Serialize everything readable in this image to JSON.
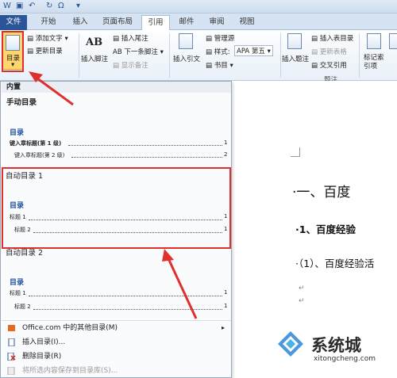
{
  "tabs": {
    "file": "文件",
    "home": "开始",
    "insert": "插入",
    "layout": "页面布局",
    "references": "引用",
    "mailings": "邮件",
    "review": "审阅",
    "view": "视图"
  },
  "ribbon": {
    "toc_button": "目录",
    "add_text": "添加文字",
    "update_toc": "更新目录",
    "insert_footnote": "插入脚注",
    "insert_endnote": "插入尾注",
    "next_footnote": "下一条脚注",
    "show_notes": "显示备注",
    "insert_citation": "插入引文",
    "manage_sources": "管理源",
    "style_label": "样式:",
    "style_value": "APA 第五",
    "bibliography": "书目",
    "insert_caption": "插入题注",
    "insert_table_of_figures": "插入表目录",
    "update_table": "更新表格",
    "cross_reference": "交叉引用",
    "captions_group": "题注",
    "mark_entry": "标记索引项",
    "footnote_icon_text": "AB",
    "citations_group_tail": "目"
  },
  "menu": {
    "header": "内置",
    "manual_title": "手动目录",
    "manual_preview": {
      "heading": "目录",
      "lines": [
        {
          "text": "键入章标题(第 1 级)",
          "page": "1"
        },
        {
          "text": "键入章标题(第 2 级)",
          "page": "2"
        }
      ]
    },
    "auto1_title": "自动目录 1",
    "auto1_preview": {
      "heading": "目录",
      "lines": [
        {
          "text": "标题 1",
          "page": "1"
        },
        {
          "text": "标题 2",
          "page": "1"
        }
      ]
    },
    "auto2_title": "自动目录 2",
    "auto2_preview": {
      "heading": "目录",
      "lines": [
        {
          "text": "标题 1",
          "page": "1"
        },
        {
          "text": "标题 2",
          "page": "1"
        }
      ]
    },
    "items": [
      {
        "label": "Office.com 中的其他目录(M)",
        "icon": "office-icon",
        "disabled": false
      },
      {
        "label": "插入目录(I)...",
        "icon": "document-icon",
        "disabled": false
      },
      {
        "label": "删除目录(R)",
        "icon": "delete-icon",
        "disabled": false
      },
      {
        "label": "将所选内容保存到目录库(S)...",
        "icon": "save-icon",
        "disabled": true
      }
    ]
  },
  "document": {
    "h1": "·一、百度",
    "h2": "·1、百度经验",
    "h3": "·（1）、百度经验活",
    "para_mark": "↵"
  },
  "watermark": {
    "brand": "系统城",
    "url": "xitongcheng.com"
  },
  "colors": {
    "accent": "#2a5699",
    "highlight": "#e0302d",
    "toc_heading": "#1f4f9f"
  }
}
